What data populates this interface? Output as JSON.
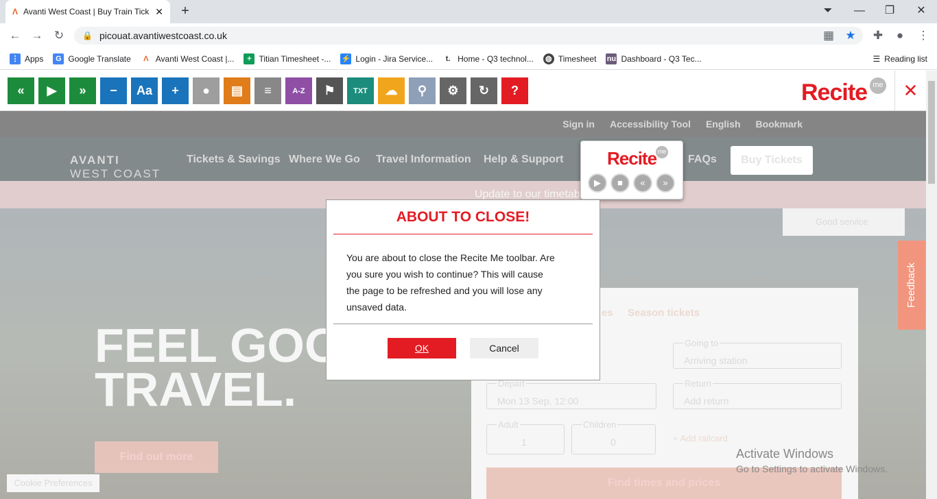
{
  "browser": {
    "tab_title": "Avanti West Coast | Buy Train Tick",
    "url": "picouat.avantiwestcoast.co.uk",
    "bookmarks": [
      {
        "label": "Apps",
        "color": "#4285f4"
      },
      {
        "label": "Google Translate",
        "color": "#4285f4"
      },
      {
        "label": "Avanti West Coast |...",
        "color": "#e8622c"
      },
      {
        "label": "Titian Timesheet -...",
        "color": "#0f9d58"
      },
      {
        "label": "Login - Jira Service...",
        "color": "#2684ff"
      },
      {
        "label": "Home - Q3 technol...",
        "color": "#333333"
      },
      {
        "label": "Timesheet",
        "color": "#444444"
      },
      {
        "label": "Dashboard - Q3 Tec...",
        "color": "#6b5b7b"
      }
    ],
    "reading_list": "Reading list"
  },
  "recite_toolbar": {
    "logo": "Recite",
    "me": "me",
    "buttons": [
      {
        "icon": "rewind-icon",
        "color": "#1c8c3c",
        "glyph": "«"
      },
      {
        "icon": "play-icon",
        "color": "#1c8c3c",
        "glyph": "▶"
      },
      {
        "icon": "fast-forward-icon",
        "color": "#1c8c3c",
        "glyph": "»"
      },
      {
        "icon": "decrease-text-icon",
        "color": "#1a74bb",
        "glyph": "−"
      },
      {
        "icon": "font-icon",
        "color": "#1a74bb",
        "glyph": "Aa"
      },
      {
        "icon": "increase-text-icon",
        "color": "#1a74bb",
        "glyph": "+"
      },
      {
        "icon": "color-wheel-icon",
        "color": "#9e9e9e",
        "glyph": "●"
      },
      {
        "icon": "ruler-icon",
        "color": "#e07c1a",
        "glyph": "▤"
      },
      {
        "icon": "text-only-icon",
        "color": "#888888",
        "glyph": "≡"
      },
      {
        "icon": "dictionary-icon",
        "color": "#8e4fa5",
        "glyph": "A-Z"
      },
      {
        "icon": "translate-icon",
        "color": "#555555",
        "glyph": "⚑"
      },
      {
        "icon": "text-mode-icon",
        "color": "#1c8c7c",
        "glyph": "TXT"
      },
      {
        "icon": "download-icon",
        "color": "#f1a51c",
        "glyph": "☁"
      },
      {
        "icon": "magnifier-icon",
        "color": "#8ea0b8",
        "glyph": "⚲"
      },
      {
        "icon": "settings-icon",
        "color": "#666666",
        "glyph": "⚙"
      },
      {
        "icon": "reset-icon",
        "color": "#666666",
        "glyph": "↻"
      },
      {
        "icon": "user-guide-icon",
        "color": "#e31b23",
        "glyph": "?"
      }
    ],
    "popup_logo": "Recite",
    "popup_me": "me"
  },
  "site": {
    "top_links": [
      "Sign in",
      "Accessibility Tool",
      "English",
      "Bookmark"
    ],
    "brand": "AVANTI",
    "brand2": "WEST COAST",
    "nav": [
      "Tickets & Savings",
      "Where We Go",
      "Travel Information",
      "Help & Support",
      "FAQs"
    ],
    "buy_tickets": "Buy Tickets",
    "banner": "Update to our timetable",
    "good_service": "Good service",
    "hero_title_1": "FEEL GOO",
    "hero_title_2": "TRAVEL.",
    "find_out_more": "Find out more",
    "cookie": "Cookie Preferences",
    "feedback": "Feedback",
    "tabs": [
      "es",
      "Season tickets"
    ],
    "going_to_label": "Going to",
    "going_to_placeholder": "Arriving station",
    "depart_label": "Depart",
    "depart_value": "Mon 13 Sep, 12:00",
    "return_label": "Return",
    "return_placeholder": "Add return",
    "adult_label": "Adult",
    "adult_value": "1",
    "children_label": "Children",
    "children_value": "0",
    "railcard": "+ Add railcard",
    "find_times": "Find times and prices"
  },
  "dialog": {
    "title": "ABOUT TO CLOSE!",
    "message": "You are about to close the Recite Me toolbar. Are you sure you wish to continue? This will cause the page to be refreshed and you will lose any unsaved data.",
    "ok": "OK",
    "cancel": "Cancel"
  },
  "watermark": {
    "line1": "Activate Windows",
    "line2": "Go to Settings to activate Windows."
  }
}
